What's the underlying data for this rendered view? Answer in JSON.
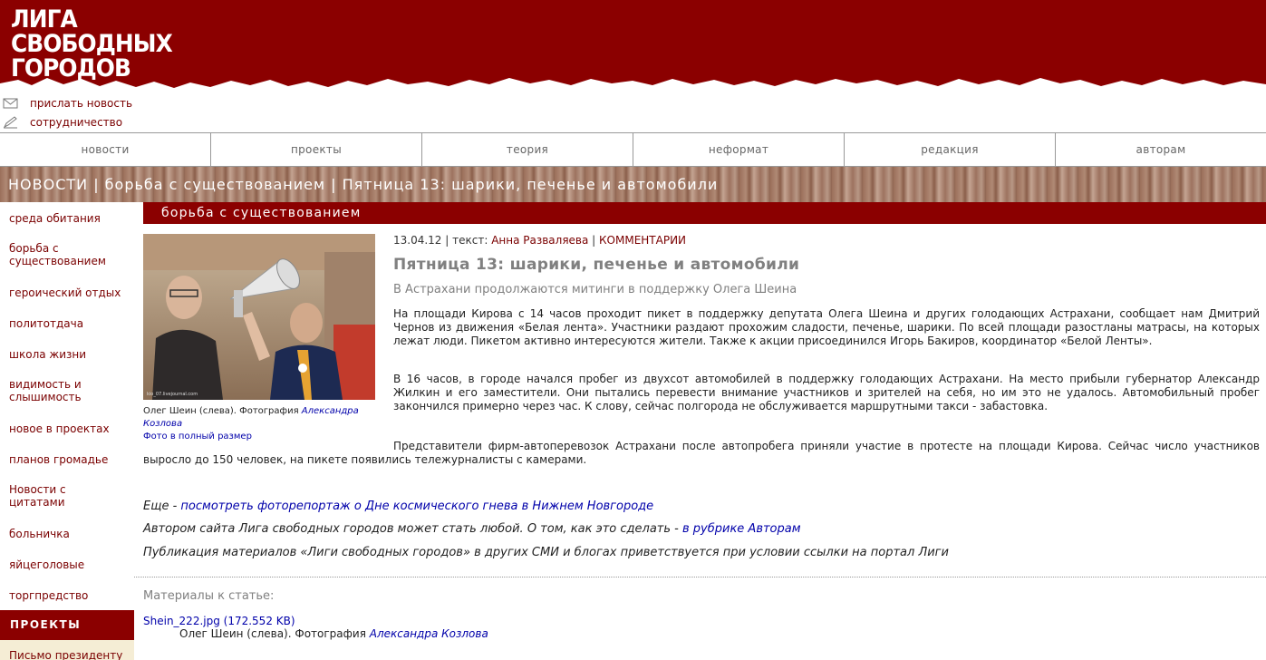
{
  "header": {
    "logo_lines": [
      "ЛИГА",
      "СВОБОДНЫХ",
      "ГОРОДОВ"
    ]
  },
  "utility": {
    "send_news": "прислать новость",
    "cooperation": "сотрудничество"
  },
  "nav": {
    "items": [
      "новости",
      "проекты",
      "теория",
      "неформат",
      "редакция",
      "авторам"
    ]
  },
  "breadcrumb": "НОВОСТИ | борьба с существованием | Пятница 13: шарики, печенье и автомобили",
  "sidebar": {
    "items": [
      "среда обитания",
      "борьба с существованием",
      "героический отдых",
      "политотдача",
      "школа жизни",
      "видимость и слышимость",
      "новое в проектах",
      "планов громадье",
      "Новости с цитатами",
      "больничка",
      "яйцеголовые",
      "торгпредство"
    ],
    "projects_head": "ПРОЕКТЫ",
    "projects_first": "Письмо президенту"
  },
  "section_title": "борьба с существованием",
  "photo": {
    "caption_prefix": "Олег Шеин (слева). Фотография ",
    "caption_author": "Александра Козлова",
    "full_size": "Фото в полный размер",
    "watermark": "kio_07.livejournal.com"
  },
  "article": {
    "date": "13.04.12",
    "text_label": " | текст: ",
    "author": "Анна Разваляева",
    "sep": " | ",
    "comments": "КОММЕНТАРИИ",
    "title": "Пятница 13: шарики, печенье и автомобили",
    "subtitle": "В Астрахани продолжаются митинги в поддержку Олега Шеина",
    "p1": "На площади Кирова с 14 часов проходит пикет в поддержку депутата Олега Шеина и других голодающих Астрахани, сообщает нам Дмитрий Чернов из движения «Белая лента». Участники раздают прохожим сладости, печенье, шарики. По всей площади разостланы матрасы, на которых лежат люди. Пикетом активно интересуются жители. Также к акции присоединился Игорь Бакиров, координатор «Белой Ленты».",
    "p2": "В 16 часов, в городе начался пробег из двухсот автомобилей в поддержку голодающих Астрахани. На место прибыли губернатор Александр Жилкин и его заместители. Они пытались перевести внимание участников и зрителей на себя, но им это не удалось. Автомобильный пробег  закончился примерно через час. К слову, сейчас полгорода не обслуживается маршрутными такси - забастовка.",
    "p3": "Представители фирм-автоперевозок Астрахани после автопробега приняли участие  в протесте на площади Кирова. Сейчас число участников выросло до 150 человек, на пикете появились тележурналисты с камерами."
  },
  "footer_notes": {
    "more_prefix": "Еще - ",
    "more_link": "посмотреть фоторепортаж о Дне космического гнева в Нижнем Новгороде",
    "author_prefix": "Автором сайта Лига свободных городов может стать любой. О том, как это сделать - ",
    "author_link": "в рубрике Авторам",
    "publication": "Публикация материалов «Лиги свободных городов» в других СМИ и блогах приветствуется при условии ссылки на портал Лиги"
  },
  "materials": {
    "label": "Материалы к статье:",
    "file": "Shein_222.jpg (172.552 KB)",
    "cap_prefix": "Олег Шеин (слева). Фотография ",
    "cap_author": "Александра Козлова"
  },
  "colors": {
    "brand_red": "#8b0000",
    "link_red": "#7a0000",
    "link_blue": "#0000aa"
  }
}
